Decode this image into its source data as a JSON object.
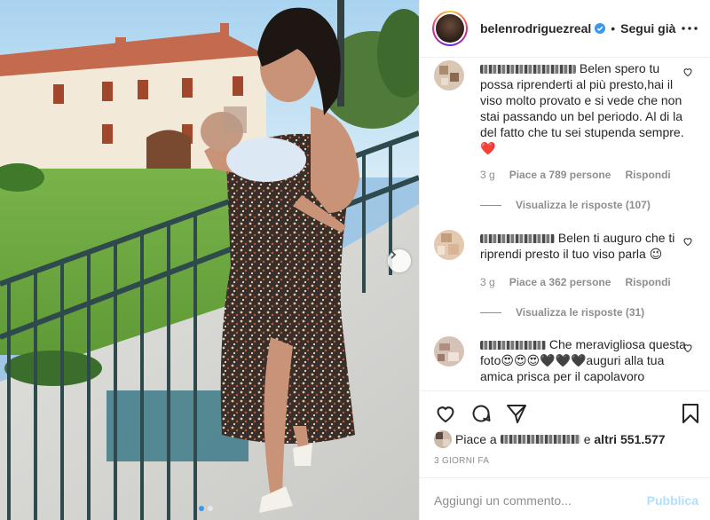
{
  "header": {
    "username": "belenrodriguezreal",
    "separator": "•",
    "follow_label": "Segui già",
    "verified_icon": "verified-badge-icon",
    "more_icon": "more-options-icon"
  },
  "comments": [
    {
      "text": "Belen spero tu possa riprenderti al più presto,hai il viso molto provato e si vede che non stai passando un bel periodo. Al di la del fatto che tu sei stupenda sempre. ❤️",
      "time": "3 g",
      "likes": "Piace a 789 persone",
      "reply": "Rispondi",
      "view_replies": "Visualizza le risposte (107)"
    },
    {
      "text": "Belen ti auguro che ti riprendi presto il tuo viso parla 😉",
      "time": "3 g",
      "likes": "Piace a 362 persone",
      "reply": "Rispondi",
      "view_replies": "Visualizza le risposte (31)"
    },
    {
      "text": "Che meravigliosa questa foto😍😍😍🖤🖤🖤auguri alla tua amica prisca per il capolavoro",
      "time": "",
      "likes": "",
      "reply": "",
      "view_replies": ""
    }
  ],
  "actions": {
    "like_icon": "heart-outline-icon",
    "comment_icon": "comment-bubble-icon",
    "share_icon": "paper-plane-icon",
    "save_icon": "bookmark-icon"
  },
  "likes": {
    "prefix": "Piace a",
    "conjunction": "e",
    "others": "altri 551.577"
  },
  "date": "3 GIORNI FA",
  "add_comment": {
    "placeholder": "Aggiungi un commento...",
    "publish": "Pubblica"
  },
  "carousel": {
    "current": 1,
    "total": 2
  },
  "colors": {
    "accent": "#3897f0",
    "publish_disabled": "#b2dffc",
    "heart_red": "#ed4956"
  }
}
